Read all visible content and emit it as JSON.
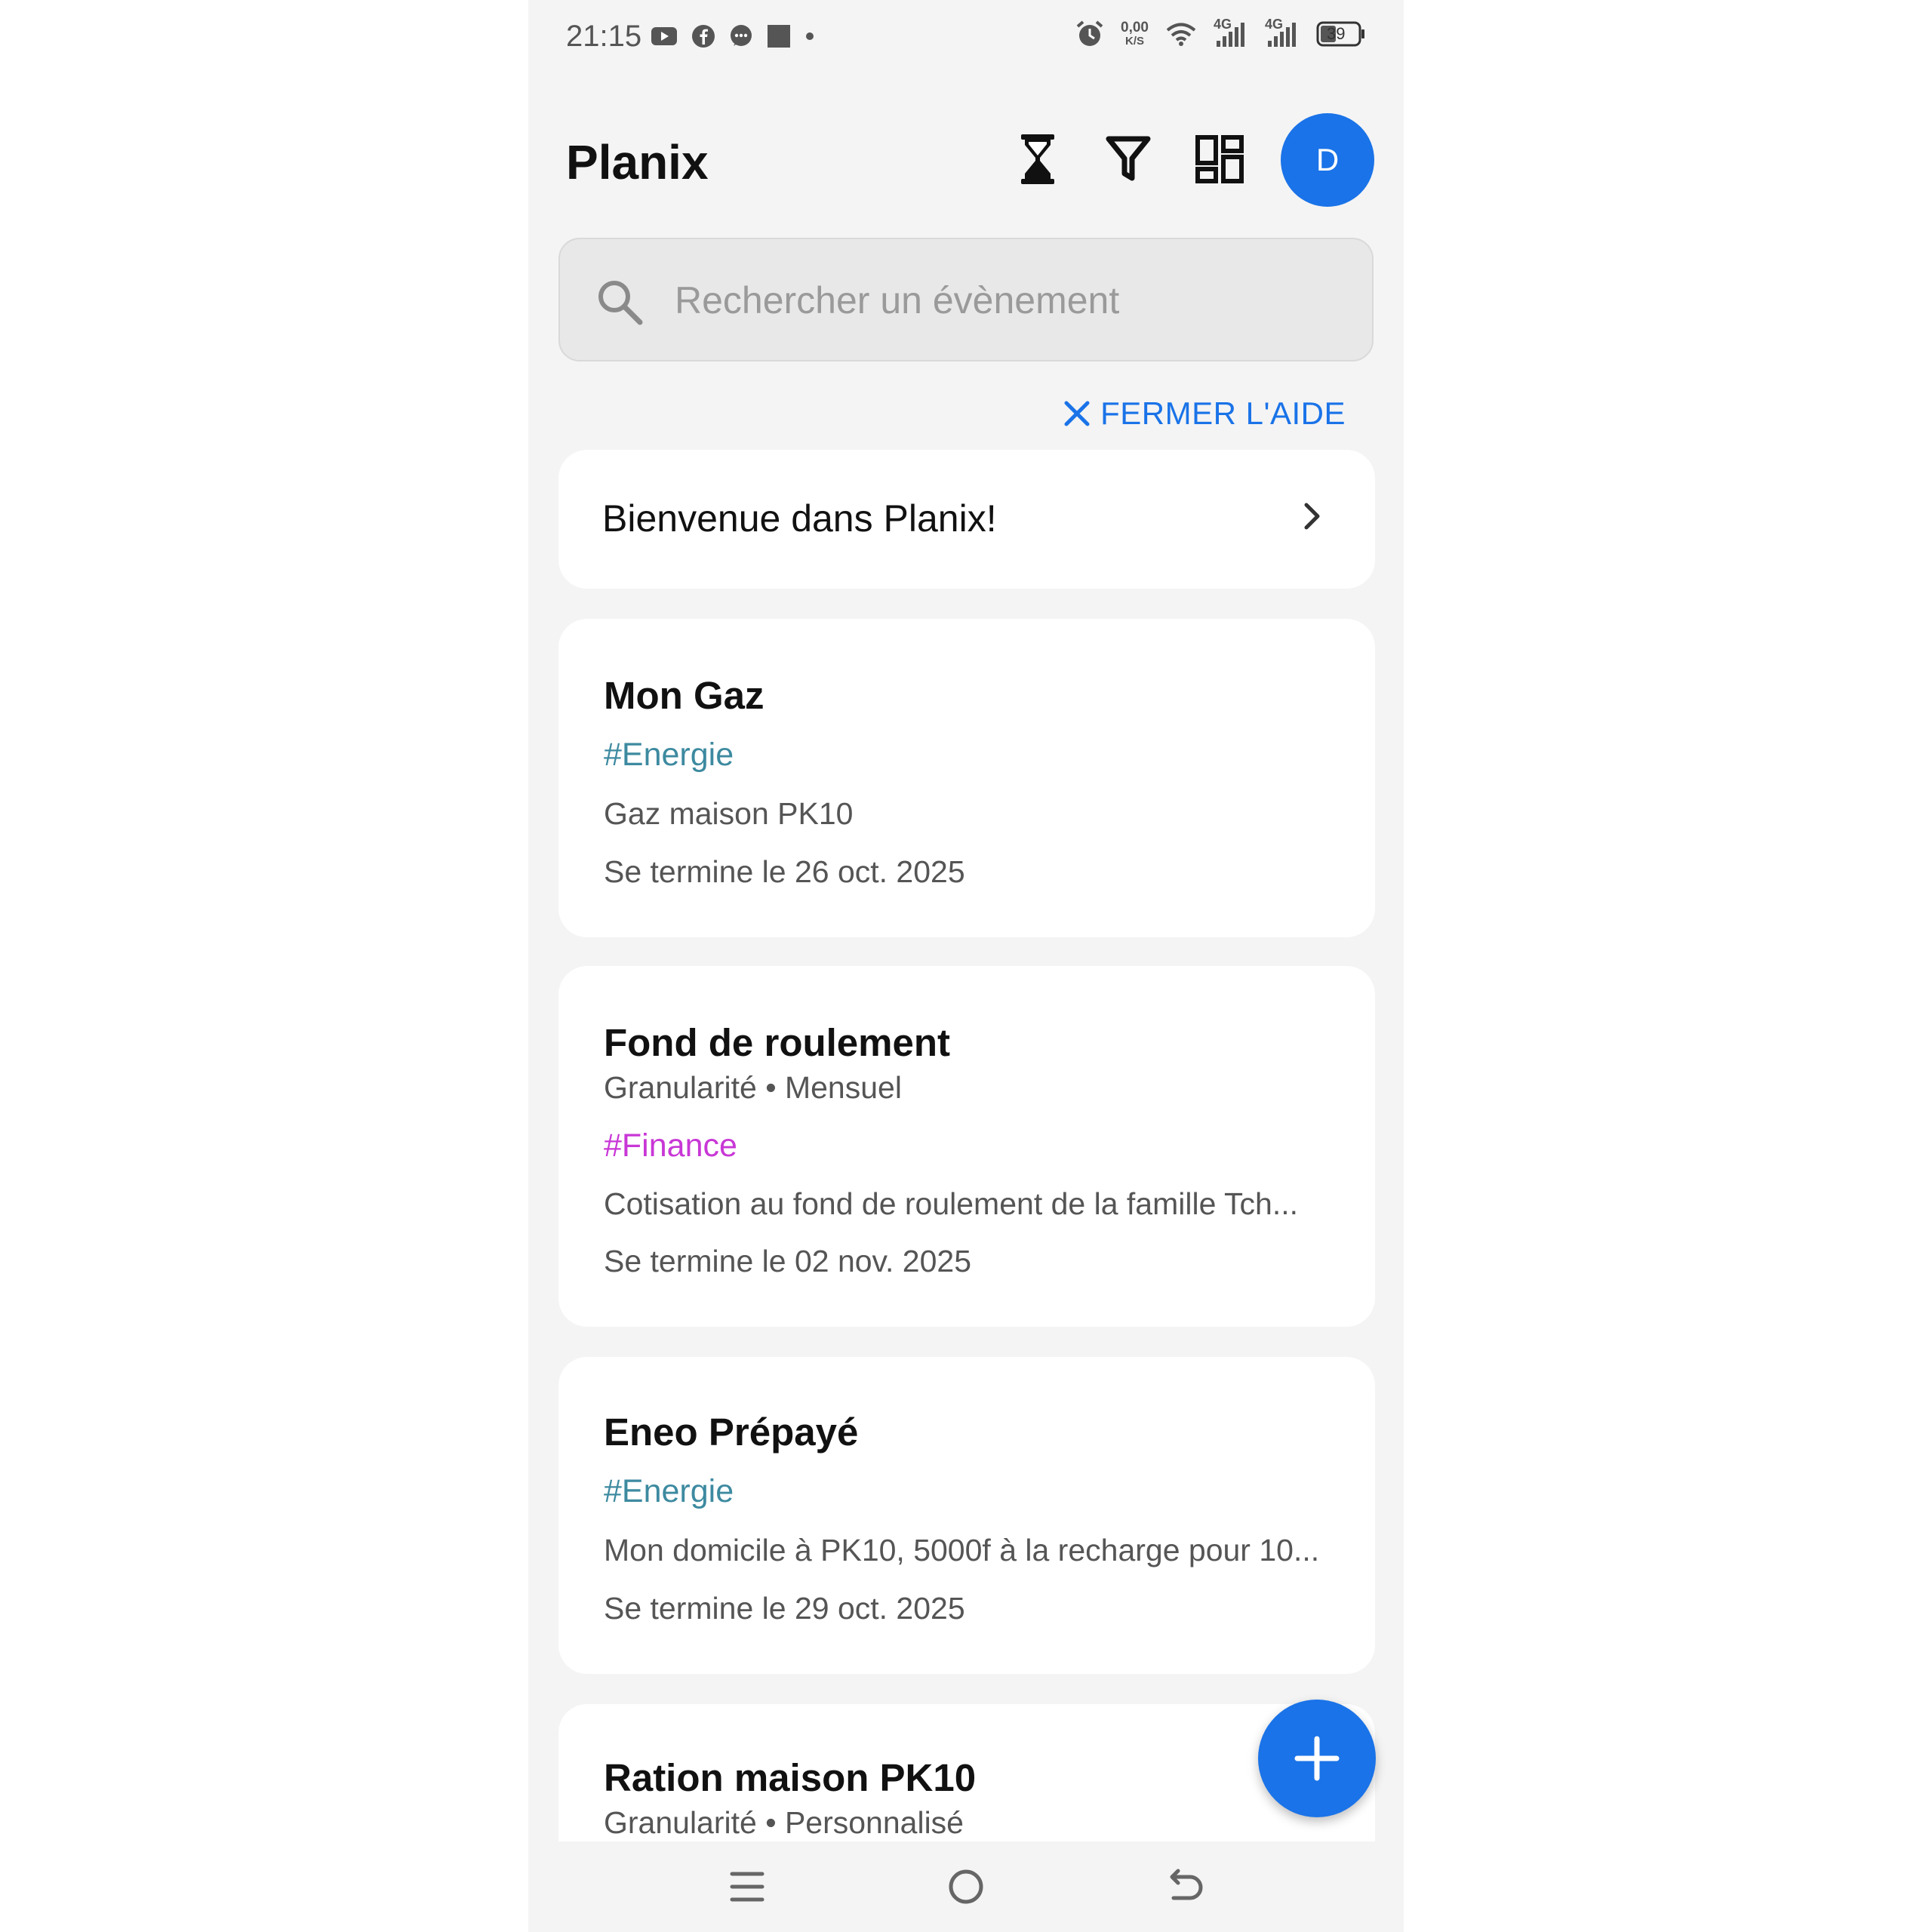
{
  "status_bar": {
    "time": "21:15",
    "net_speed_value": "0,00",
    "net_speed_unit": "K/S",
    "network_1": "4G",
    "network_2": "4G",
    "battery": "39"
  },
  "header": {
    "title": "Planix",
    "avatar_initial": "D"
  },
  "search": {
    "placeholder": "Rechercher un évènement"
  },
  "help": {
    "close_label": "FERMER L'AIDE"
  },
  "welcome_card": {
    "label": "Bienvenue dans Planix!"
  },
  "events": [
    {
      "title": "Mon Gaz",
      "tag": "#Energie",
      "description": "Gaz maison PK10",
      "end_date": "Se termine le 26 oct. 2025"
    },
    {
      "title": "Fond de roulement",
      "granularity": "Granularité • Mensuel",
      "tag": "#Finance",
      "description": "Cotisation au fond de roulement de la famille Tch...",
      "end_date": "Se termine le 02 nov. 2025"
    },
    {
      "title": "Eneo Prépayé",
      "tag": "#Energie",
      "description": "Mon domicile à PK10, 5000f à la recharge pour 10...",
      "end_date": "Se termine le 29 oct. 2025"
    },
    {
      "title": "Ration maison PK10",
      "granularity": "Granularité • Personnalisé"
    }
  ],
  "colors": {
    "accent": "#1a73e8",
    "tag_energie": "#3d8aa0",
    "tag_finance": "#c837d6",
    "background": "#f4f4f4"
  },
  "icons": {
    "header": [
      "hourglass-icon",
      "filter-icon",
      "dashboard-icon"
    ],
    "fab": "add-icon",
    "nav": [
      "menu-icon",
      "home-icon",
      "back-icon"
    ]
  }
}
